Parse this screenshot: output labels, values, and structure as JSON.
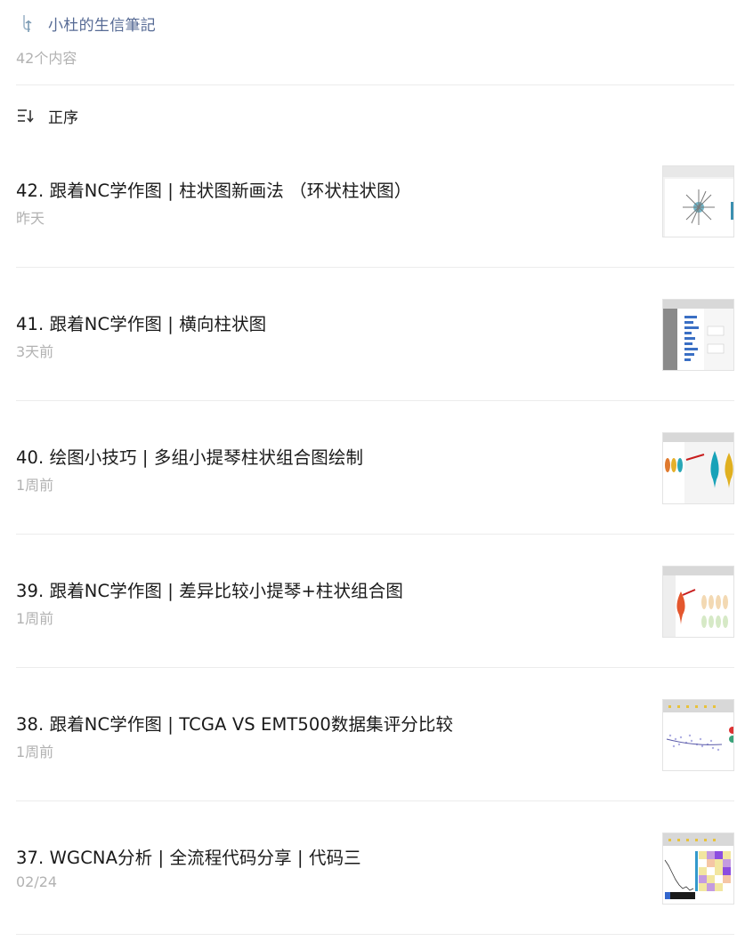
{
  "album": {
    "name": "小杜的生信筆記",
    "icon": "album-icon",
    "count_label": "42个内容"
  },
  "sort": {
    "icon": "sort-order-icon",
    "label": "正序"
  },
  "articles": [
    {
      "title": "42. 跟着NC学作图 | 柱状图新画法 （环状柱状图）",
      "date": "昨天",
      "thumbnail": "circular-bar-chart-thumbnail"
    },
    {
      "title": "41. 跟着NC学作图 | 横向柱状图",
      "date": "3天前",
      "thumbnail": "horizontal-bar-chart-thumbnail"
    },
    {
      "title": "40. 绘图小技巧 | 多组小提琴柱状组合图绘制",
      "date": "1周前",
      "thumbnail": "violin-bar-combo-thumbnail"
    },
    {
      "title": "39. 跟着NC学作图 | 差异比较小提琴+柱状组合图",
      "date": "1周前",
      "thumbnail": "violin-diff-thumbnail"
    },
    {
      "title": "38. 跟着NC学作图 | TCGA VS EMT500数据集评分比较",
      "date": "1周前",
      "thumbnail": "scatter-comparison-thumbnail"
    },
    {
      "title": "37. WGCNA分析 | 全流程代码分享 | 代码三",
      "date": "02/24",
      "thumbnail": "wgcna-heatmap-thumbnail"
    }
  ],
  "colors": {
    "album_link": "#576b95",
    "muted_text": "#b2b2b2",
    "divider": "#ececec"
  }
}
